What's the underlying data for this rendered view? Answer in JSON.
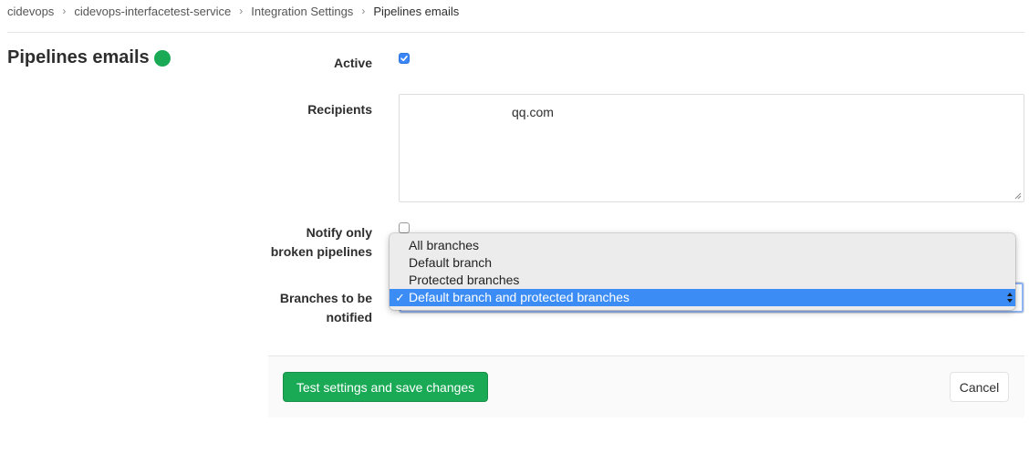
{
  "breadcrumb": {
    "items": [
      "cidevops",
      "cidevops-interfacetest-service",
      "Integration Settings",
      "Pipelines emails"
    ],
    "separator": "›"
  },
  "page": {
    "title": "Pipelines emails",
    "status_color": "#1aaa55"
  },
  "form": {
    "active": {
      "label": "Active",
      "checked": true
    },
    "recipients": {
      "label": "Recipients",
      "value": "qq.com"
    },
    "notify_broken": {
      "label_line1": "Notify only",
      "label_line2": "broken pipelines",
      "checked": false
    },
    "branches": {
      "label_line1": "Branches to be",
      "label_line2": "notified",
      "options": [
        "All branches",
        "Default branch",
        "Protected branches",
        "Default branch and protected branches"
      ],
      "selected": "Default branch and protected branches",
      "check_mark": "✓"
    }
  },
  "footer": {
    "save_label": "Test settings and save changes",
    "cancel_label": "Cancel"
  },
  "colors": {
    "accent_green": "#1aaa55",
    "checkbox_blue": "#3b86f7",
    "selection_blue": "#3b8cf5"
  }
}
